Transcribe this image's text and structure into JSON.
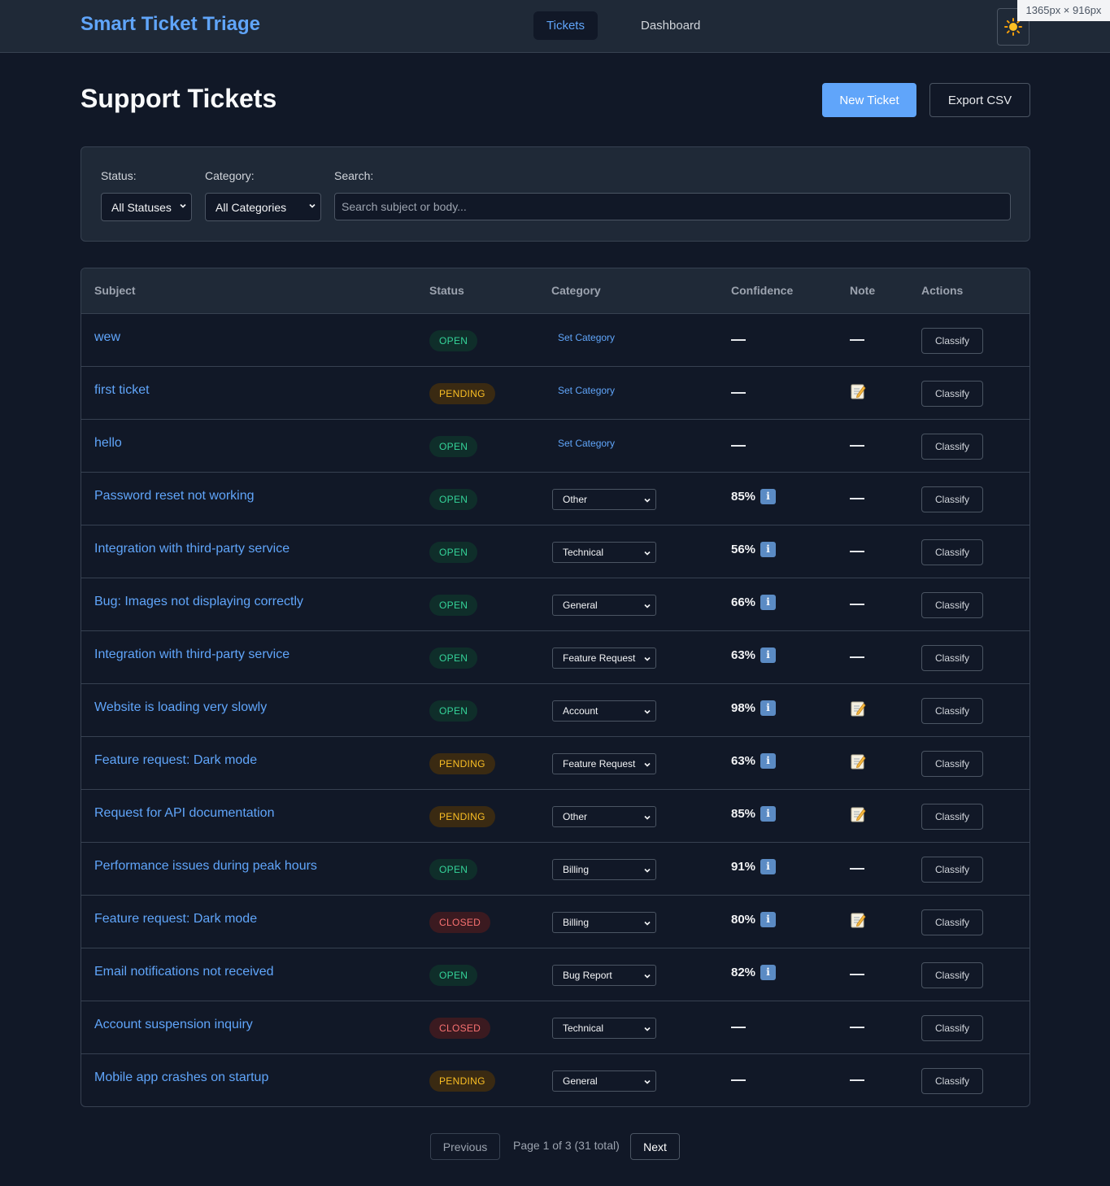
{
  "app": {
    "brand": "Smart Ticket Triage",
    "nav": [
      {
        "label": "Tickets",
        "active": true
      },
      {
        "label": "Dashboard",
        "active": false
      }
    ],
    "theme_toggle_icon": "sun-icon",
    "viewport_badge": "1365px × 916px"
  },
  "header": {
    "title": "Support Tickets",
    "new_ticket_label": "New Ticket",
    "export_label": "Export CSV"
  },
  "filters": {
    "status_label": "Status:",
    "status_value": "All Statuses",
    "category_label": "Category:",
    "category_value": "All Categories",
    "search_label": "Search:",
    "search_placeholder": "Search subject or body..."
  },
  "table": {
    "columns": [
      "Subject",
      "Status",
      "Category",
      "Confidence",
      "Note",
      "Actions"
    ],
    "set_category_label": "Set Category",
    "classify_label": "Classify",
    "rows": [
      {
        "subject": "wew",
        "status": "OPEN",
        "category": null,
        "confidence": null,
        "note": false
      },
      {
        "subject": "first ticket",
        "status": "PENDING",
        "category": null,
        "confidence": null,
        "note": true
      },
      {
        "subject": "hello",
        "status": "OPEN",
        "category": null,
        "confidence": null,
        "note": false
      },
      {
        "subject": "Password reset not working",
        "status": "OPEN",
        "category": "Other",
        "confidence": "85%",
        "note": false
      },
      {
        "subject": "Integration with third-party service",
        "status": "OPEN",
        "category": "Technical",
        "confidence": "56%",
        "note": false
      },
      {
        "subject": "Bug: Images not displaying correctly",
        "status": "OPEN",
        "category": "General",
        "confidence": "66%",
        "note": false
      },
      {
        "subject": "Integration with third-party service",
        "status": "OPEN",
        "category": "Feature Request",
        "confidence": "63%",
        "note": false
      },
      {
        "subject": "Website is loading very slowly",
        "status": "OPEN",
        "category": "Account",
        "confidence": "98%",
        "note": true
      },
      {
        "subject": "Feature request: Dark mode",
        "status": "PENDING",
        "category": "Feature Request",
        "confidence": "63%",
        "note": true
      },
      {
        "subject": "Request for API documentation",
        "status": "PENDING",
        "category": "Other",
        "confidence": "85%",
        "note": true
      },
      {
        "subject": "Performance issues during peak hours",
        "status": "OPEN",
        "category": "Billing",
        "confidence": "91%",
        "note": false
      },
      {
        "subject": "Feature request: Dark mode",
        "status": "CLOSED",
        "category": "Billing",
        "confidence": "80%",
        "note": true
      },
      {
        "subject": "Email notifications not received",
        "status": "OPEN",
        "category": "Bug Report",
        "confidence": "82%",
        "note": false
      },
      {
        "subject": "Account suspension inquiry",
        "status": "CLOSED",
        "category": "Technical",
        "confidence": null,
        "note": false
      },
      {
        "subject": "Mobile app crashes on startup",
        "status": "PENDING",
        "category": "General",
        "confidence": null,
        "note": false
      }
    ]
  },
  "pagination": {
    "previous_label": "Previous",
    "info": "Page 1 of 3 (31 total)",
    "next_label": "Next"
  }
}
